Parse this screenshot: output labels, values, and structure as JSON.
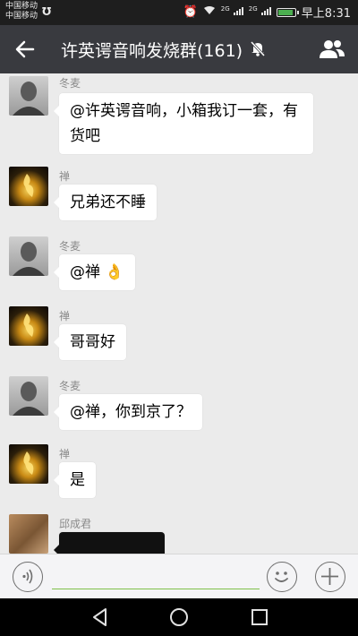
{
  "status_bar": {
    "carrier_1": "中国移动",
    "carrier_2": "中国移动",
    "time": "早上8:31",
    "signal_1": "2G",
    "signal_2": "2G"
  },
  "header": {
    "title": "许英谔音响发烧群(161)"
  },
  "messages": [
    {
      "sender": "冬麦",
      "text": "@许英谔音响，小箱我订一套，有货吧"
    },
    {
      "sender": "禅",
      "text": "兄弟还不睡"
    },
    {
      "sender": "冬麦",
      "text": "@禅 👌"
    },
    {
      "sender": "禅",
      "text": "哥哥好"
    },
    {
      "sender": "冬麦",
      "text": "@禅，你到京了？"
    },
    {
      "sender": "禅",
      "text": "是"
    },
    {
      "sender": "邱成君",
      "text": ""
    }
  ]
}
